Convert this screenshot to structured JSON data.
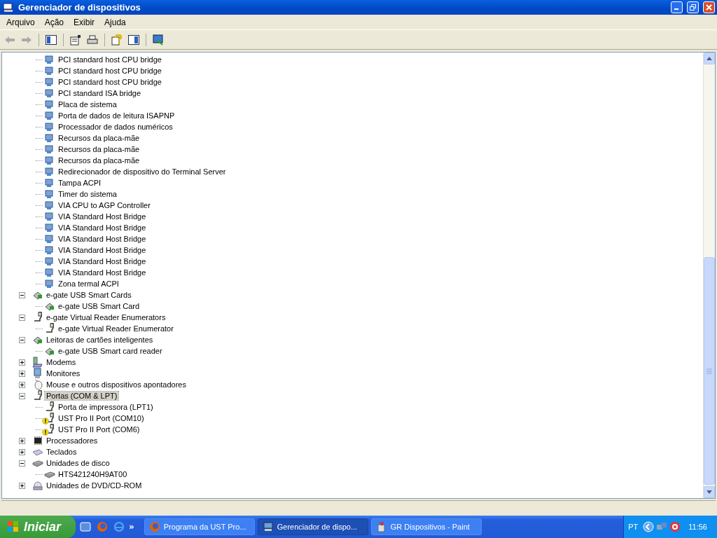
{
  "window": {
    "title": "Gerenciador de dispositivos"
  },
  "menu": [
    "Arquivo",
    "Ação",
    "Exibir",
    "Ajuda"
  ],
  "tree": {
    "continued_children": [
      {
        "label": "PCI standard host CPU bridge",
        "warning": false
      },
      {
        "label": "PCI standard host CPU bridge",
        "warning": false
      },
      {
        "label": "PCI standard host CPU bridge",
        "warning": false
      },
      {
        "label": "PCI standard ISA bridge",
        "warning": false
      },
      {
        "label": "Placa de sistema",
        "warning": false
      },
      {
        "label": "Porta de dados de leitura ISAPNP",
        "warning": false
      },
      {
        "label": "Processador de dados numéricos",
        "warning": false
      },
      {
        "label": "Recursos da placa-mãe",
        "warning": false
      },
      {
        "label": "Recursos da placa-mãe",
        "warning": false
      },
      {
        "label": "Recursos da placa-mãe",
        "warning": false
      },
      {
        "label": "Redirecionador de dispositivo do Terminal Server",
        "warning": false
      },
      {
        "label": "Tampa ACPI",
        "warning": false
      },
      {
        "label": "Timer do sistema",
        "warning": false
      },
      {
        "label": "VIA CPU to AGP Controller",
        "warning": false
      },
      {
        "label": "VIA Standard Host Bridge",
        "warning": false
      },
      {
        "label": "VIA Standard Host Bridge",
        "warning": false
      },
      {
        "label": "VIA Standard Host Bridge",
        "warning": false
      },
      {
        "label": "VIA Standard Host Bridge",
        "warning": false
      },
      {
        "label": "VIA Standard Host Bridge",
        "warning": false
      },
      {
        "label": "VIA Standard Host Bridge",
        "warning": false
      },
      {
        "label": "Zona termal ACPI",
        "warning": false
      }
    ],
    "nodes": [
      {
        "label": "e-gate USB Smart Cards",
        "kind": "smartcard",
        "expanded": true,
        "selected": false,
        "children": [
          {
            "label": "e-gate USB Smart Card",
            "warning": false
          }
        ]
      },
      {
        "label": "e-gate Virtual Reader Enumerators",
        "kind": "port",
        "expanded": true,
        "selected": false,
        "children": [
          {
            "label": "e-gate Virtual Reader Enumerator",
            "warning": false
          }
        ]
      },
      {
        "label": "Leitoras de cartões inteligentes",
        "kind": "smartcard",
        "expanded": true,
        "selected": false,
        "children": [
          {
            "label": "e-gate USB Smart card reader",
            "warning": false
          }
        ]
      },
      {
        "label": "Modems",
        "kind": "modem",
        "expanded": false,
        "selected": false
      },
      {
        "label": "Monitores",
        "kind": "monitor",
        "expanded": false,
        "selected": false
      },
      {
        "label": "Mouse e outros dispositivos apontadores",
        "kind": "mouse",
        "expanded": false,
        "selected": false
      },
      {
        "label": "Portas (COM & LPT)",
        "kind": "port",
        "expanded": true,
        "selected": true,
        "children": [
          {
            "label": "Porta de impressora (LPT1)",
            "warning": false
          },
          {
            "label": "UST Pro II Port (COM10)",
            "warning": true
          },
          {
            "label": "UST Pro II Port (COM6)",
            "warning": true
          }
        ]
      },
      {
        "label": "Processadores",
        "kind": "cpu",
        "expanded": false,
        "selected": false
      },
      {
        "label": "Teclados",
        "kind": "keyboard",
        "expanded": false,
        "selected": false
      },
      {
        "label": "Unidades de disco",
        "kind": "disk",
        "expanded": true,
        "selected": false,
        "children": [
          {
            "label": "HTS421240H9AT00",
            "warning": false
          }
        ]
      },
      {
        "label": "Unidades de DVD/CD-ROM",
        "kind": "dvd",
        "expanded": false,
        "selected": false
      }
    ]
  },
  "taskbar": {
    "start": "Iniciar",
    "more": "»",
    "tasks": [
      {
        "label": "Programa da UST Pro...",
        "kind": "browser",
        "selected": false
      },
      {
        "label": "Gerenciador de dispo...",
        "kind": "computer",
        "selected": true
      },
      {
        "label": "GR Dispositivos - Paint",
        "kind": "paint",
        "selected": false
      }
    ],
    "language": "PT",
    "clock": "11:56"
  }
}
